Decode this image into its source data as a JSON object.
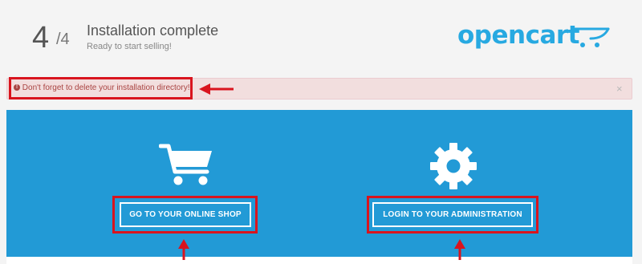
{
  "header": {
    "step_current": "4",
    "step_total": "/4",
    "title": "Installation complete",
    "subtitle": "Ready to start selling!"
  },
  "logo": {
    "text": "opencart",
    "color": "#27a9e1"
  },
  "alert": {
    "icon": "exclamation-circle-icon",
    "message": "Don't forget to delete your installation directory!",
    "close": "×"
  },
  "panel": {
    "color": "#229ad6",
    "shop": {
      "icon": "shopping-cart-icon",
      "label": "GO TO YOUR ONLINE SHOP"
    },
    "admin": {
      "icon": "gear-icon",
      "label": "LOGIN TO YOUR ADMINISTRATION"
    }
  },
  "annotations": {
    "color": "#d9141e"
  }
}
